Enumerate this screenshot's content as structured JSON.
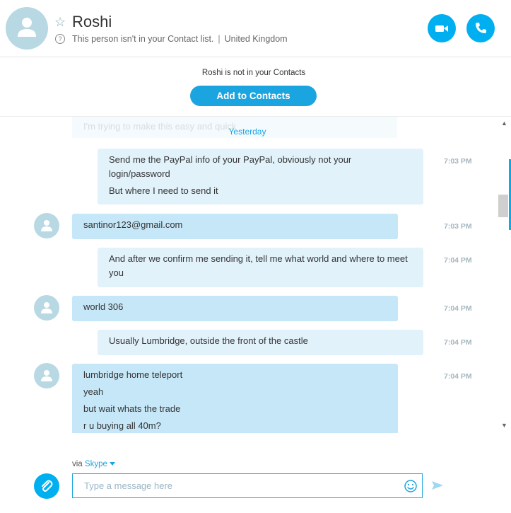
{
  "header": {
    "contact_name": "Roshi",
    "status_text": "This person isn't in your Contact list.",
    "separator": "|",
    "location": "United Kingdom"
  },
  "banner": {
    "text": "Roshi is not in your Contacts",
    "add_button_label": "Add to Contacts"
  },
  "chat": {
    "faded_text": "I'm trying to make this easy and quick",
    "day_label": "Yesterday",
    "messages": [
      {
        "direction": "outgoing",
        "lines": [
          "Send me the PayPal info of your PayPal, obviously not your login/password",
          "But where I need to send it"
        ],
        "time": "7:03 PM"
      },
      {
        "direction": "incoming",
        "lines": [
          "santinor123@gmail.com"
        ],
        "time": "7:03 PM"
      },
      {
        "direction": "outgoing",
        "lines": [
          "And after we confirm me sending it, tell me what world and where to meet you"
        ],
        "time": "7:04 PM"
      },
      {
        "direction": "incoming",
        "lines": [
          "world 306"
        ],
        "time": "7:04 PM"
      },
      {
        "direction": "outgoing",
        "lines": [
          "Usually Lumbridge, outside the front of the castle"
        ],
        "time": "7:04 PM"
      },
      {
        "direction": "incoming",
        "lines": [
          "lumbridge home teleport",
          "yeah",
          "but wait whats the trade",
          "r u buying all 40m?"
        ],
        "time": "7:04 PM"
      }
    ]
  },
  "composer": {
    "via_label": "via",
    "via_service": "Skype",
    "placeholder": "Type a message here"
  },
  "colors": {
    "accent": "#00aff0",
    "incoming_bubble": "#c6e7f7",
    "outgoing_bubble": "#e2f2fb"
  },
  "icons": [
    "user-avatar-icon",
    "star-icon",
    "info-icon",
    "video-call-icon",
    "phone-call-icon",
    "paperclip-icon",
    "emoji-icon",
    "send-icon"
  ]
}
